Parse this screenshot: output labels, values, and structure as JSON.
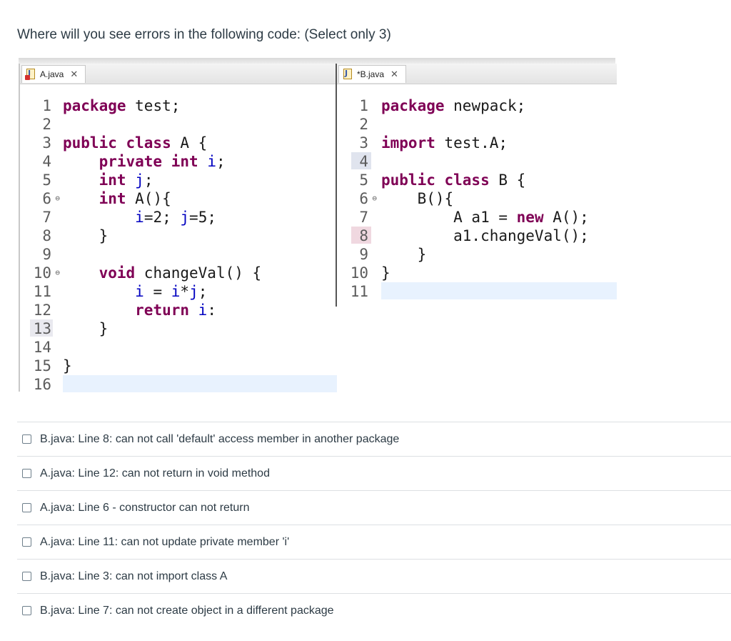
{
  "question": "Where will you see errors in the following code: (Select only 3)",
  "editor": {
    "tab_a": "A.java",
    "tab_b": "*B.java",
    "file_a": [
      {
        "n": "1",
        "parts": [
          [
            "kw",
            "package"
          ],
          [
            "t",
            " test;"
          ]
        ]
      },
      {
        "n": "2",
        "parts": []
      },
      {
        "n": "3",
        "parts": [
          [
            "kw",
            "public class"
          ],
          [
            "t",
            " A {"
          ]
        ]
      },
      {
        "n": "4",
        "parts": [
          [
            "t",
            "    "
          ],
          [
            "kw",
            "private int"
          ],
          [
            "t",
            " "
          ],
          [
            "f",
            "i"
          ],
          [
            "t",
            ";"
          ]
        ]
      },
      {
        "n": "5",
        "parts": [
          [
            "t",
            "    "
          ],
          [
            "kw",
            "int"
          ],
          [
            "t",
            " "
          ],
          [
            "f",
            "j"
          ],
          [
            "t",
            ";"
          ]
        ]
      },
      {
        "n": "6",
        "fold": true,
        "parts": [
          [
            "t",
            "    "
          ],
          [
            "kw",
            "int"
          ],
          [
            "t",
            " A(){"
          ]
        ]
      },
      {
        "n": "7",
        "parts": [
          [
            "t",
            "        "
          ],
          [
            "f",
            "i"
          ],
          [
            "t",
            "=2; "
          ],
          [
            "f",
            "j"
          ],
          [
            "t",
            "=5;"
          ]
        ]
      },
      {
        "n": "8",
        "parts": [
          [
            "t",
            "    }"
          ]
        ]
      },
      {
        "n": "9",
        "parts": []
      },
      {
        "n": "10",
        "fold": true,
        "parts": [
          [
            "t",
            "    "
          ],
          [
            "kw",
            "void"
          ],
          [
            "t",
            " changeVal() {"
          ]
        ]
      },
      {
        "n": "11",
        "parts": [
          [
            "t",
            "        "
          ],
          [
            "f",
            "i"
          ],
          [
            "t",
            " = "
          ],
          [
            "f",
            "i"
          ],
          [
            "t",
            "*"
          ],
          [
            "f",
            "j"
          ],
          [
            "t",
            ";"
          ]
        ]
      },
      {
        "n": "12",
        "parts": [
          [
            "t",
            "        "
          ],
          [
            "kw",
            "return"
          ],
          [
            "t",
            " "
          ],
          [
            "f",
            "i"
          ],
          [
            "t",
            ":"
          ]
        ]
      },
      {
        "n": "13",
        "parts": [
          [
            "t",
            "    }"
          ]
        ]
      },
      {
        "n": "14",
        "parts": []
      },
      {
        "n": "15",
        "parts": [
          [
            "t",
            "}"
          ]
        ]
      },
      {
        "n": "16",
        "parts": []
      }
    ],
    "file_b": [
      {
        "n": "1",
        "parts": [
          [
            "kw",
            "package"
          ],
          [
            "t",
            " newpack;"
          ]
        ]
      },
      {
        "n": "2",
        "parts": []
      },
      {
        "n": "3",
        "parts": [
          [
            "kw",
            "import"
          ],
          [
            "t",
            " test.A;"
          ]
        ]
      },
      {
        "n": "4",
        "parts": []
      },
      {
        "n": "5",
        "parts": [
          [
            "kw",
            "public class"
          ],
          [
            "t",
            " B {"
          ]
        ]
      },
      {
        "n": "6",
        "fold": true,
        "parts": [
          [
            "t",
            "    B(){"
          ]
        ]
      },
      {
        "n": "7",
        "parts": [
          [
            "t",
            "        A a1 = "
          ],
          [
            "kw",
            "new"
          ],
          [
            "t",
            " A();"
          ]
        ]
      },
      {
        "n": "8",
        "parts": [
          [
            "t",
            "        a1.changeVal();"
          ]
        ]
      },
      {
        "n": "9",
        "parts": [
          [
            "t",
            "    }"
          ]
        ]
      },
      {
        "n": "10",
        "parts": [
          [
            "t",
            "}"
          ]
        ]
      },
      {
        "n": "11",
        "parts": []
      }
    ]
  },
  "options": [
    "B.java: Line 8: can not call 'default' access member in another package",
    "A.java: Line 12: can not return in void method",
    "A.java: Line 6 - constructor can not return",
    "A.java: Line 11: can not update private member 'i'",
    "B.java: Line 3: can not import class A",
    "B.java: Line 7: can not create object in a different package"
  ]
}
